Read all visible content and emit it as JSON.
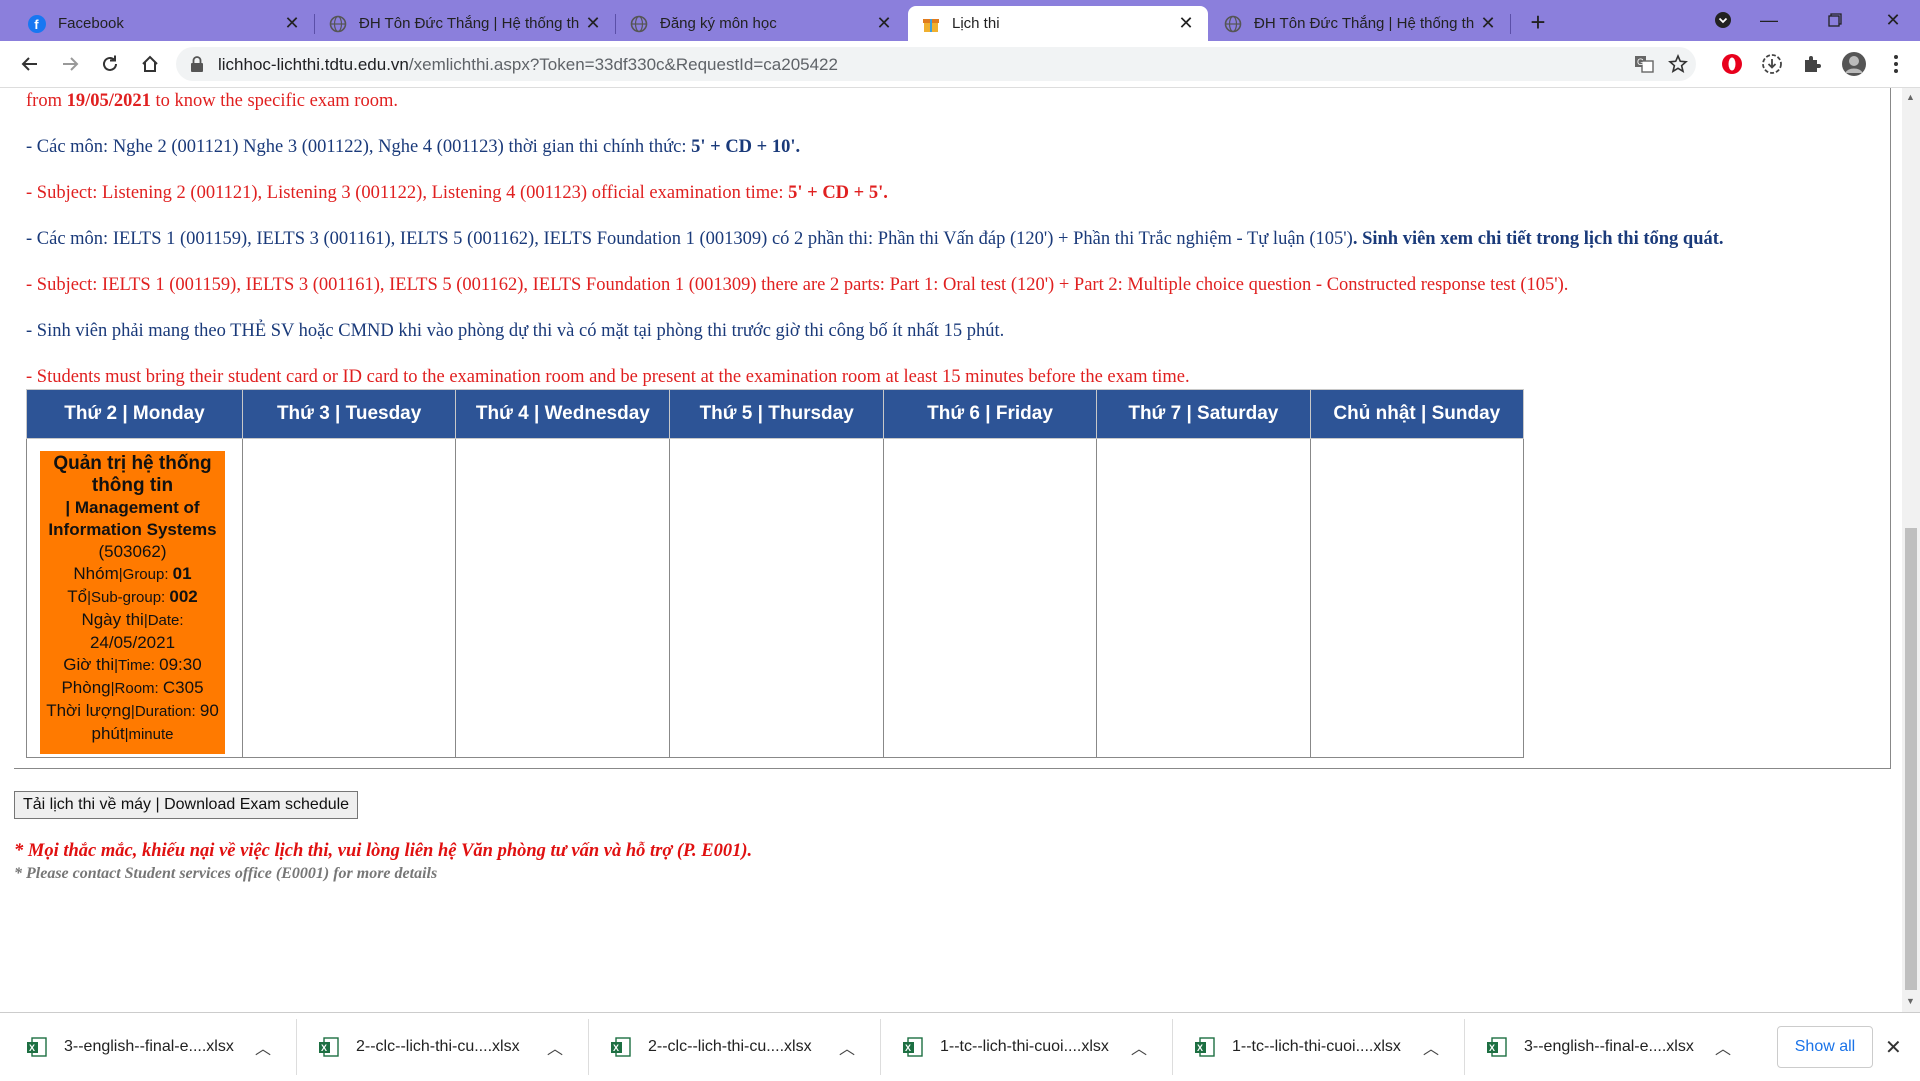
{
  "tabs": [
    {
      "title": "Facebook",
      "icon": "facebook-icon"
    },
    {
      "title": "ĐH Tôn Đức Thắng | Hệ thống th",
      "icon": "globe-icon"
    },
    {
      "title": "Đăng ký môn học",
      "icon": "globe-icon"
    },
    {
      "title": "Lịch thi",
      "icon": "gift-icon"
    },
    {
      "title": "ĐH Tôn Đức Thắng | Hệ thống th",
      "icon": "globe-icon"
    }
  ],
  "address": {
    "host": "lichhoc-lichthi.tdtu.edu.vn",
    "path": "/xemlichthi.aspx?Token=33df330c&RequestId=ca205422"
  },
  "notes": {
    "line1_prefix": "from ",
    "line1_date": "19/05/2021",
    "line1_suffix": " to know the specific exam room.",
    "line2_text": "- Các môn: Nghe 2 (001121) Nghe 3 (001122), Nghe 4 (001123) thời gian thi chính thức: ",
    "line2_bold": "5' + CD + 10'.",
    "line3_text": "- Subject: Listening 2 (001121), Listening 3 (001122), Listening 4 (001123) official examination time: ",
    "line3_bold": "5' + CD + 5'.",
    "line4_text": "- Các môn: IELTS 1 (001159), IELTS 3 (001161), IELTS 5 (001162), IELTS Foundation 1 (001309) có 2 phần thi: Phần thi Vấn đáp (120') + Phần thi Trắc nghiệm - Tự luận (105')",
    "line4_bold": ". Sinh viên xem chi tiết trong lịch thi tổng quát.",
    "line5": "- Subject: IELTS 1 (001159), IELTS 3 (001161), IELTS 5 (001162), IELTS Foundation 1 (001309) there are 2 parts: Part 1: Oral test (120') + Part 2: Multiple choice question - Constructed response test (105').",
    "line6": "- Sinh viên phải mang theo THẺ SV hoặc CMND khi vào phòng dự thi và có mặt tại phòng thi trước giờ thi công bố ít nhất 15 phút.",
    "line7": "- Students must bring their student card or ID card to the examination room and be present at the examination room at least 15 minutes before the exam time."
  },
  "schedule": {
    "headers": [
      "Thứ 2 | Monday",
      "Thứ 3 | Tuesday",
      "Thứ 4 | Wednesday",
      "Thứ 5 | Thursday",
      "Thứ 6 | Friday",
      "Thứ 7 | Saturday",
      "Chủ nhật | Sunday"
    ],
    "exam": {
      "title_vi": "Quản trị hệ thống thông tin",
      "title_en": "| Management of Information Systems",
      "code": "(503062)",
      "group_label": "Nhóm",
      "group_label_en": "|Group: ",
      "group": "01",
      "subgroup_label": "Tổ",
      "subgroup_label_en": "|Sub-group: ",
      "subgroup": "002",
      "date_label": "Ngày thi",
      "date_label_en": "|Date:",
      "date": "24/05/2021",
      "time_label": "Giờ thi",
      "time_label_en": "|Time: ",
      "time": "09:30",
      "room_label": "Phòng",
      "room_label_en": "|Room: ",
      "room": "C305",
      "duration_label": "Thời lượng",
      "duration_label_en": "|Duration: ",
      "duration": "90",
      "minute_label": "phút",
      "minute_label_en": "|minute"
    }
  },
  "download_button": "Tải lịch thi về máy | Download Exam schedule",
  "footer": {
    "contact_vi": "* Mọi thắc mắc, khiếu nại về việc lịch thi, vui lòng liên hệ Văn phòng tư vấn và hỗ trợ (P. E001).",
    "contact_en": "* Please contact Student services office (E0001) for more details"
  },
  "downloads": [
    "3--english--final-e....xlsx",
    "2--clc--lich-thi-cu....xlsx",
    "2--clc--lich-thi-cu....xlsx",
    "1--tc--lich-thi-cuoi....xlsx",
    "1--tc--lich-thi-cuoi....xlsx",
    "3--english--final-e....xlsx"
  ],
  "show_all": "Show all",
  "colors": {
    "tabbar": "#8b7fdc",
    "table_header": "#2d5496",
    "exam_card": "#ff7a00",
    "text_vi": "#1a3a7a",
    "text_en": "#e02020"
  }
}
